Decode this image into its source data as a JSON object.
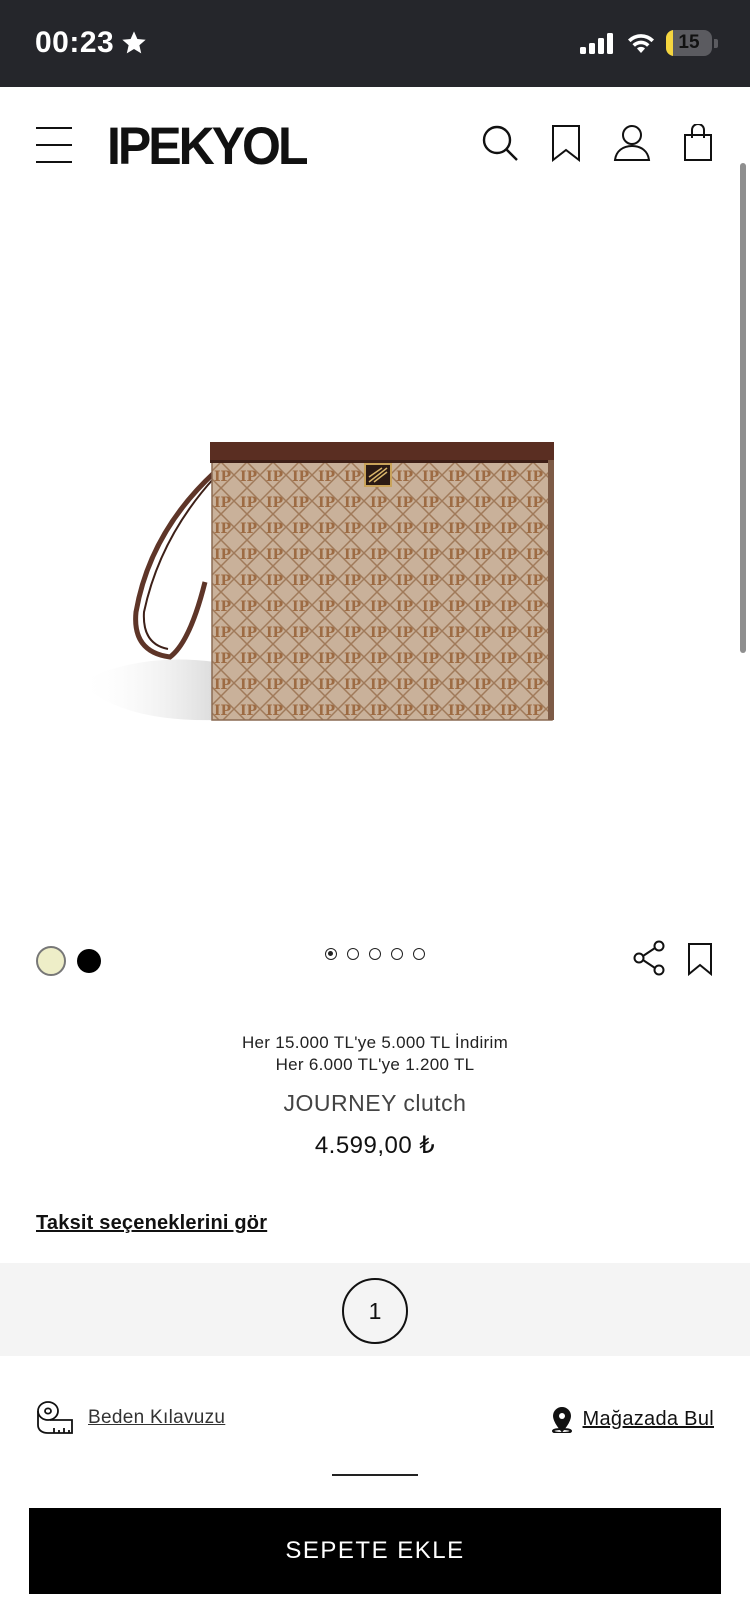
{
  "status_bar": {
    "time": "00:23",
    "battery_level": "15",
    "battery_fraction": 0.15
  },
  "header": {
    "logo": "IPEKYOL",
    "icons": [
      "menu-icon",
      "search-icon",
      "bookmark-icon",
      "user-icon",
      "shopping-bag-icon"
    ]
  },
  "gallery": {
    "image_count": 5,
    "active_index": 0
  },
  "colors": {
    "swatches": [
      "#eeeec8",
      "#000000"
    ],
    "selected": "#eeeec8"
  },
  "promo": {
    "line1": "Her 15.000 TL'ye 5.000 TL İndirim",
    "line2": "Her 6.000 TL'ye 1.200 TL"
  },
  "product": {
    "title": "JOURNEY clutch",
    "price": "4.599,00 ₺"
  },
  "installment_link": "Taksit seçeneklerini gör",
  "size": {
    "options": [
      "1"
    ],
    "selected": "1"
  },
  "links": {
    "size_guide": "Beden Kılavuzu",
    "find_in_store": "Mağazada Bul"
  },
  "cta": {
    "add_to_cart": "SEPETE EKLE"
  },
  "theme": {
    "status_bar_bg": "#25262b",
    "size_bar_bg": "#f4f4f4",
    "cta_bg": "#000000",
    "battery_color": "#f5d53f"
  }
}
